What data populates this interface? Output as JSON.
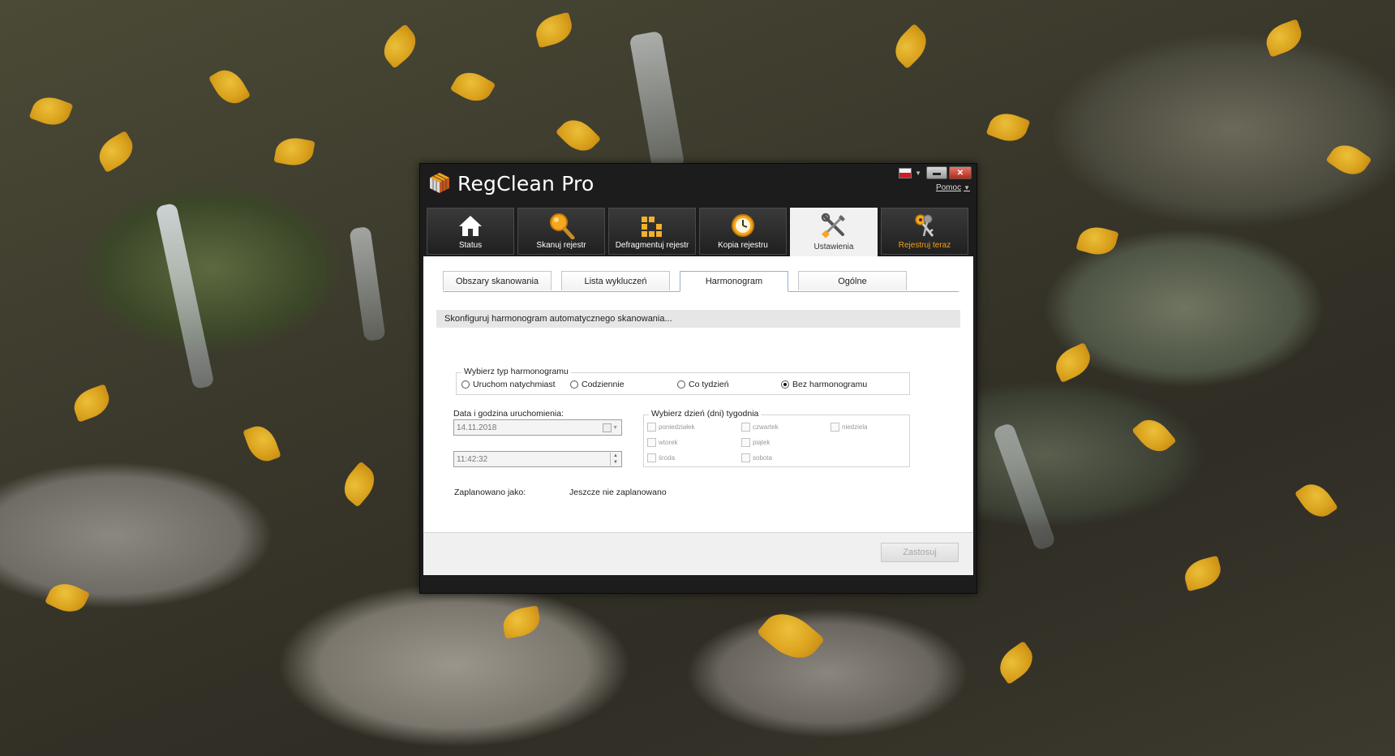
{
  "window": {
    "title": "RegClean Pro",
    "help_label": "Pomoc",
    "flag_icon": "poland-flag-icon"
  },
  "toolbar": {
    "items": [
      {
        "label": "Status",
        "icon": "home-icon"
      },
      {
        "label": "Skanuj rejestr",
        "icon": "magnifier-icon"
      },
      {
        "label": "Defragmentuj rejestr",
        "icon": "blocks-icon"
      },
      {
        "label": "Kopia rejestru",
        "icon": "clock-icon"
      },
      {
        "label": "Ustawienia",
        "icon": "tools-icon",
        "active": true
      },
      {
        "label": "Rejestruj teraz",
        "icon": "keys-icon"
      }
    ]
  },
  "subtabs": {
    "items": [
      {
        "label": "Obszary skanowania"
      },
      {
        "label": "Lista wykluczeń"
      },
      {
        "label": "Harmonogram",
        "active": true
      },
      {
        "label": "Ogólne"
      }
    ]
  },
  "schedule": {
    "info": "Skonfiguruj harmonogram automatycznego skanowania...",
    "type_legend": "Wybierz typ harmonogramu",
    "types": [
      {
        "label": "Uruchom natychmiast",
        "selected": false
      },
      {
        "label": "Codziennie",
        "selected": false
      },
      {
        "label": "Co tydzień",
        "selected": false
      },
      {
        "label": "Bez harmonogramu",
        "selected": true
      }
    ],
    "datetime_label": "Data i godzina uruchomienia:",
    "date_value": "14.11.2018",
    "time_value": "11:42:32",
    "days_legend": "Wybierz dzień (dni) tygodnia",
    "days": [
      "poniedziałek",
      "wtorek",
      "środa",
      "czwartek",
      "piątek",
      "sobota",
      "niedziela"
    ],
    "scheduled_label": "Zaplanowano jako:",
    "scheduled_value": "Jeszcze nie zaplanowano",
    "apply_label": "Zastosuj"
  }
}
